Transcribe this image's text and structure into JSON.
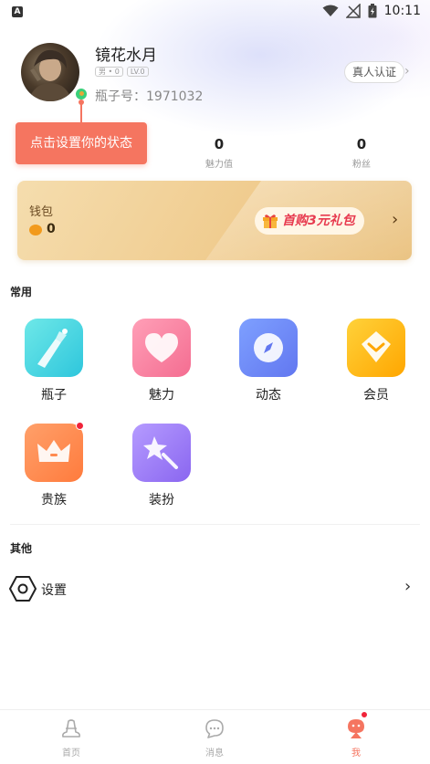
{
  "status_bar": {
    "time": "10:11"
  },
  "profile": {
    "username": "镜花水月",
    "badges": [
      "男 • 0",
      "LV.0"
    ],
    "bottle_id": "瓶子号：1971032",
    "verify_label": "真人认证"
  },
  "tooltip": {
    "text": "点击设置你的状态"
  },
  "stats": [
    {
      "value": "0",
      "label": "魅力值"
    },
    {
      "value": "0",
      "label": "粉丝"
    }
  ],
  "wallet": {
    "title": "钱包",
    "balance": "0",
    "promo": "首购3元礼包"
  },
  "sections": {
    "common_title": "常用",
    "other_title": "其他"
  },
  "common_items": [
    {
      "label": "瓶子",
      "icon": "bottle-icon",
      "color": "#3fd5e0"
    },
    {
      "label": "魅力",
      "icon": "heart-icon",
      "color": "#f7799a"
    },
    {
      "label": "动态",
      "icon": "compass-icon",
      "color": "#6f8cf7"
    },
    {
      "label": "会员",
      "icon": "diamond-icon",
      "color": "#ffb300"
    },
    {
      "label": "贵族",
      "icon": "crown-icon",
      "color": "#ff8a50"
    },
    {
      "label": "装扮",
      "icon": "magic-wand-icon",
      "color": "#9a7cf5"
    }
  ],
  "other_items": [
    {
      "label": "设置",
      "icon": "settings-icon"
    }
  ],
  "tabbar": {
    "items": [
      {
        "label": "首页",
        "icon": "home-bottle-icon"
      },
      {
        "label": "消息",
        "icon": "message-icon"
      },
      {
        "label": "我",
        "icon": "me-icon"
      }
    ],
    "active_color": "#f57560"
  }
}
